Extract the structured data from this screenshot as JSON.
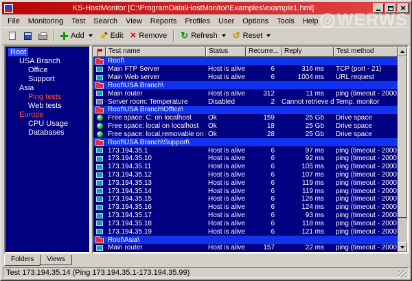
{
  "window": {
    "title": "KS-HostMonitor [C:\\ProgramData\\HostMonitor\\Examples\\example1.hml]"
  },
  "menu": {
    "items": [
      "File",
      "Monitoring",
      "Test",
      "Search",
      "View",
      "Reports",
      "Profiles",
      "User",
      "Options",
      "Tools",
      "Help"
    ]
  },
  "toolbar": {
    "add_label": "Add",
    "edit_label": "Edit",
    "remove_label": "Remove",
    "refresh_label": "Refresh",
    "reset_label": "Reset"
  },
  "tree": {
    "items": [
      {
        "label": "Root",
        "level": 0,
        "selected": true
      },
      {
        "label": "USA Branch",
        "level": 1
      },
      {
        "label": "Office",
        "level": 2
      },
      {
        "label": "Support",
        "level": 2
      },
      {
        "label": "Asia",
        "level": 1
      },
      {
        "label": "Ping tests",
        "level": 2,
        "color": "#ff4e4e"
      },
      {
        "label": "Web tests",
        "level": 2
      },
      {
        "label": "Europe",
        "level": 1,
        "color": "#ff4e4e"
      },
      {
        "label": "CPU Usage",
        "level": 2
      },
      {
        "label": "Databases",
        "level": 2
      }
    ]
  },
  "table": {
    "columns": [
      "Test name",
      "Status",
      "Recurre...",
      "Reply",
      "Test method"
    ],
    "rows": [
      {
        "type": "folder",
        "name": "Root\\"
      },
      {
        "type": "test",
        "icon": "monitor",
        "name": "Main FTP Server",
        "status": "Host is alive",
        "recurrences": "6",
        "reply": "316 ms",
        "method": "TCP (port - 21)"
      },
      {
        "type": "test",
        "icon": "monitor",
        "name": "Main Web server",
        "status": "Host is alive",
        "recurrences": "6",
        "reply": "1004 ms",
        "method": "URL request"
      },
      {
        "type": "folder",
        "name": "Root\\USA Branch\\"
      },
      {
        "type": "test",
        "icon": "monitor",
        "name": "Main router",
        "status": "Host is alive",
        "recurrences": "312",
        "reply": "11 ms",
        "method": "ping (timeout - 2000"
      },
      {
        "type": "test",
        "icon": "temp",
        "name": "Server room: Temperature",
        "status": "Disabled",
        "recurrences": "2",
        "reply": "Cannot retrieve data f...",
        "method": "Temp. monitor"
      },
      {
        "type": "folder",
        "name": "Root\\USA Branch\\Office\\"
      },
      {
        "type": "test",
        "icon": "drive",
        "name": "Free space: C: on localhost",
        "status": "Ok",
        "recurrences": "159",
        "reply": "25 Gb",
        "method": "Drive space"
      },
      {
        "type": "test",
        "icon": "drive",
        "name": "Free space: local on localhost",
        "status": "Ok",
        "recurrences": "18",
        "reply": "25 Gb",
        "method": "Drive space"
      },
      {
        "type": "test",
        "icon": "drive",
        "name": "Free space: local,removable on loc...",
        "status": "Ok",
        "recurrences": "28",
        "reply": "25 Gb",
        "method": "Drive space"
      },
      {
        "type": "folder",
        "name": "Root\\USA Branch\\Support\\"
      },
      {
        "type": "test",
        "icon": "monitor",
        "name": "173.194.35.1",
        "status": "Host is alive",
        "recurrences": "6",
        "reply": "97 ms",
        "method": "ping (timeout - 2000"
      },
      {
        "type": "test",
        "icon": "monitor",
        "name": "173.194.35.10",
        "status": "Host is alive",
        "recurrences": "6",
        "reply": "92 ms",
        "method": "ping (timeout - 2000"
      },
      {
        "type": "test",
        "icon": "monitor",
        "name": "173.194.35.11",
        "status": "Host is alive",
        "recurrences": "6",
        "reply": "105 ms",
        "method": "ping (timeout - 2000"
      },
      {
        "type": "test",
        "icon": "monitor",
        "name": "173.194.35.12",
        "status": "Host is alive",
        "recurrences": "6",
        "reply": "107 ms",
        "method": "ping (timeout - 2000"
      },
      {
        "type": "test",
        "icon": "monitor",
        "name": "173.194.35.13",
        "status": "Host is alive",
        "recurrences": "6",
        "reply": "119 ms",
        "method": "ping (timeout - 2000"
      },
      {
        "type": "test",
        "icon": "monitor",
        "name": "173.194.35.14",
        "status": "Host is alive",
        "recurrences": "6",
        "reply": "119 ms",
        "method": "ping (timeout - 2000"
      },
      {
        "type": "test",
        "icon": "monitor",
        "name": "173.194.35.15",
        "status": "Host is alive",
        "recurrences": "6",
        "reply": "126 ms",
        "method": "ping (timeout - 2000"
      },
      {
        "type": "test",
        "icon": "monitor",
        "name": "173.194.35.16",
        "status": "Host is alive",
        "recurrences": "6",
        "reply": "124 ms",
        "method": "ping (timeout - 2000"
      },
      {
        "type": "test",
        "icon": "monitor",
        "name": "173.194.35.17",
        "status": "Host is alive",
        "recurrences": "6",
        "reply": "93 ms",
        "method": "ping (timeout - 2000"
      },
      {
        "type": "test",
        "icon": "monitor",
        "name": "173.194.35.18",
        "status": "Host is alive",
        "recurrences": "6",
        "reply": "118 ms",
        "method": "ping (timeout - 2000"
      },
      {
        "type": "test",
        "icon": "monitor",
        "name": "173.194.35.19",
        "status": "Host is alive",
        "recurrences": "6",
        "reply": "121 ms",
        "method": "ping (timeout - 2000"
      },
      {
        "type": "folder",
        "name": "Root\\Asia\\"
      },
      {
        "type": "test",
        "icon": "monitor",
        "name": "Main router",
        "status": "Host is alive",
        "recurrences": "157",
        "reply": "22 ms",
        "method": "ping (timeout - 2000"
      }
    ]
  },
  "tabs": {
    "items": [
      "Folders",
      "Views"
    ]
  },
  "statusbar": {
    "text": "Test 173.194.35.14 (Ping 173.194.35.1-173.194.35.99)"
  },
  "watermark": {
    "text": "WERWS"
  },
  "colors": {
    "titlebar_red": "#c41010",
    "panel_navy": "#000080",
    "folder_row_blue": "#1133ee",
    "tree_alert_red": "#ff4e4e",
    "chrome_gray": "#d4d0c8"
  }
}
